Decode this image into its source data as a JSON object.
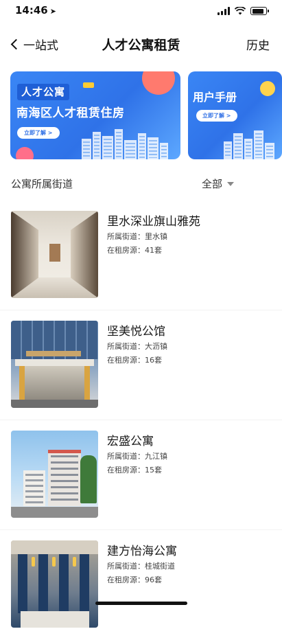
{
  "status_bar": {
    "time": "14:46",
    "battery_level": 0.85
  },
  "nav": {
    "back_label": "一站式",
    "title": "人才公寓租赁",
    "history_label": "历史"
  },
  "banners": [
    {
      "tag": "人才公寓",
      "headline": "南海区人才租赁住房",
      "button": "立即了解 >"
    },
    {
      "headline": "用户手册",
      "button": "立即了解 >"
    }
  ],
  "filter": {
    "label": "公寓所属街道",
    "selected": "全部"
  },
  "apartments": [
    {
      "name": "里水深业旗山雅苑",
      "street_label": "所属街道：",
      "street": "里水镇",
      "count_label": "在租房源：",
      "count": "41套",
      "thumb_icon": "corridor-image"
    },
    {
      "name": "坚美悦公馆",
      "street_label": "所属街道：",
      "street": "大沥镇",
      "count_label": "在租房源：",
      "count": "16套",
      "thumb_icon": "office-building-image"
    },
    {
      "name": "宏盛公寓",
      "street_label": "所属街道：",
      "street": "九江镇",
      "count_label": "在租房源：",
      "count": "15套",
      "thumb_icon": "building-exterior-image"
    },
    {
      "name": "建方怡海公寓",
      "street_label": "所属街道：",
      "street": "桂城街道",
      "count_label": "在租房源：",
      "count": "96套",
      "thumb_icon": "lobby-image"
    }
  ]
}
